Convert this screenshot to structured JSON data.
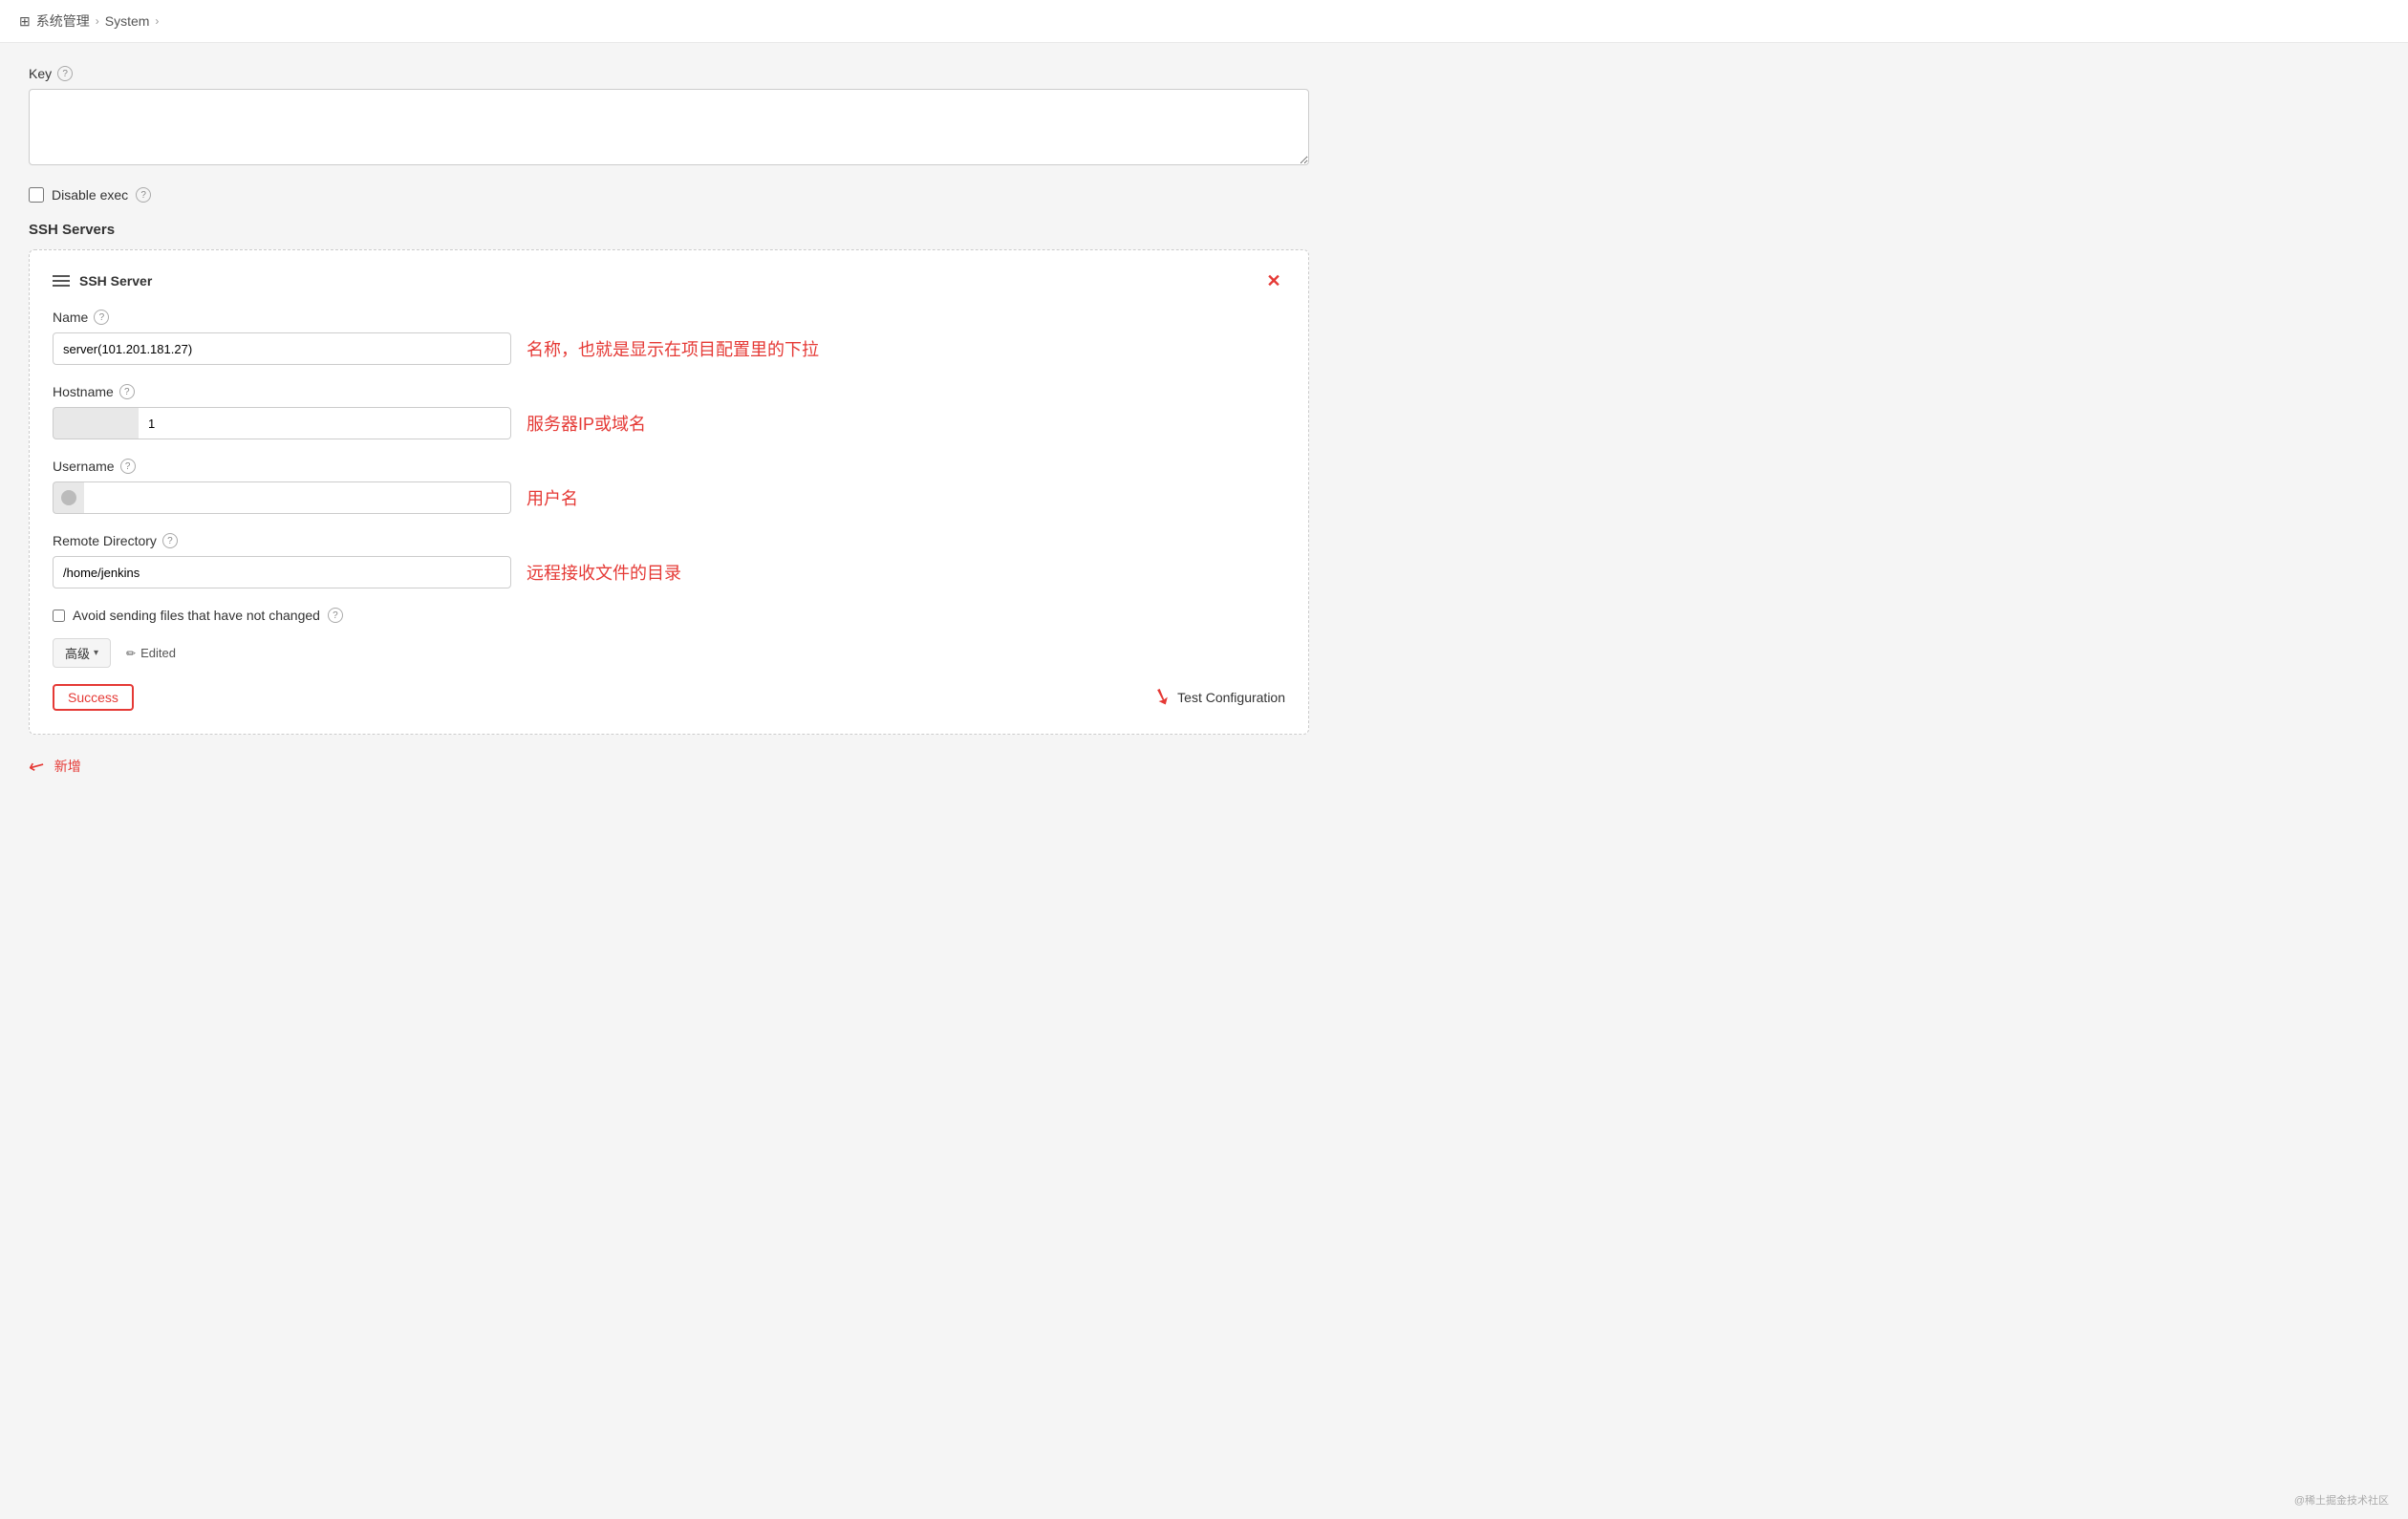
{
  "breadcrumb": {
    "items": [
      "系统管理",
      "System"
    ]
  },
  "key_section": {
    "label": "Key",
    "value": "",
    "help": "?"
  },
  "disable_exec": {
    "label": "Disable exec",
    "help": "?",
    "checked": false
  },
  "ssh_servers": {
    "section_title": "SSH Servers",
    "card": {
      "title": "SSH Server",
      "name_field": {
        "label": "Name",
        "help": "?",
        "value": "server(101.201.181.27)",
        "annotation": "名称，也就是显示在项目配置里的下拉"
      },
      "hostname_field": {
        "label": "Hostname",
        "help": "?",
        "prefix": "",
        "value": "1",
        "annotation": "服务器IP或域名"
      },
      "username_field": {
        "label": "Username",
        "help": "?",
        "value": "",
        "annotation": "用户名"
      },
      "remote_dir_field": {
        "label": "Remote Directory",
        "help": "?",
        "value": "/home/jenkins",
        "annotation": "远程接收文件的目录"
      },
      "avoid_sending": {
        "label": "Avoid sending files that have not changed",
        "help": "?",
        "checked": false
      },
      "advanced_btn": "高级",
      "edited_label": "Edited",
      "success_badge": "Success",
      "test_config_label": "Test Configuration"
    }
  },
  "add_btn": {
    "label": "新增"
  },
  "footer": {
    "text": "@稀土掘金技术社区"
  }
}
